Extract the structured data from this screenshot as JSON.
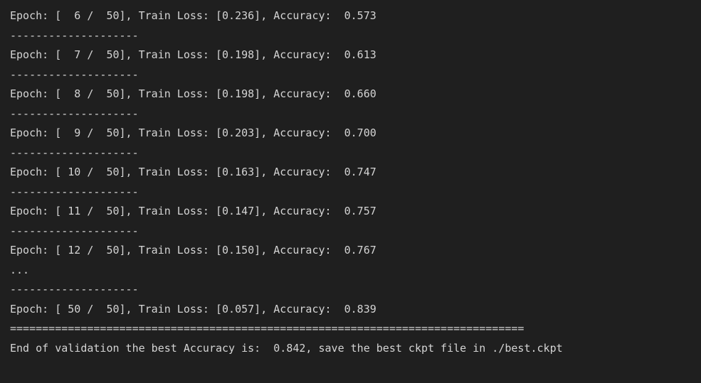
{
  "terminal": {
    "lines": [
      "Epoch: [  6 /  50], Train Loss: [0.236], Accuracy:  0.573",
      "--------------------",
      "Epoch: [  7 /  50], Train Loss: [0.198], Accuracy:  0.613",
      "--------------------",
      "Epoch: [  8 /  50], Train Loss: [0.198], Accuracy:  0.660",
      "--------------------",
      "Epoch: [  9 /  50], Train Loss: [0.203], Accuracy:  0.700",
      "--------------------",
      "Epoch: [ 10 /  50], Train Loss: [0.163], Accuracy:  0.747",
      "--------------------",
      "Epoch: [ 11 /  50], Train Loss: [0.147], Accuracy:  0.757",
      "--------------------",
      "Epoch: [ 12 /  50], Train Loss: [0.150], Accuracy:  0.767",
      "...",
      "--------------------",
      "Epoch: [ 50 /  50], Train Loss: [0.057], Accuracy:  0.839",
      "================================================================================",
      "End of validation the best Accuracy is:  0.842, save the best ckpt file in ./best.ckpt"
    ]
  }
}
